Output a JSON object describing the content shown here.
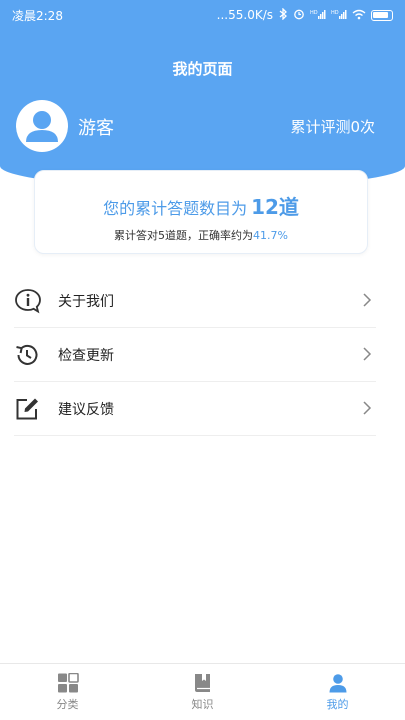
{
  "status_bar": {
    "time": "凌晨2:28",
    "network_speed": "...55.0K/s",
    "icons": [
      "bluetooth-icon",
      "alarm-icon",
      "signal-icon",
      "signal-icon",
      "wifi-icon",
      "battery-icon"
    ],
    "hd1": "HD",
    "hd2": "HD"
  },
  "header": {
    "title": "我的页面",
    "username": "游客",
    "eval_count": "累计评测0次"
  },
  "stats": {
    "main_prefix": "您的累计答题数目为",
    "main_value": "12道",
    "sub_prefix": "累计答对5道题，正确率约为",
    "sub_value": "41.7%"
  },
  "menu": {
    "items": [
      {
        "label": "关于我们",
        "icon": "info-icon"
      },
      {
        "label": "检查更新",
        "icon": "history-icon"
      },
      {
        "label": "建议反馈",
        "icon": "edit-icon"
      }
    ]
  },
  "bottom_nav": {
    "items": [
      {
        "label": "分类",
        "icon": "grid-icon"
      },
      {
        "label": "知识",
        "icon": "book-icon"
      },
      {
        "label": "我的",
        "icon": "person-icon",
        "active": true
      }
    ]
  },
  "colors": {
    "header_bg": "#5aa5f2",
    "accent": "#4d9be8",
    "text_dark": "#222222"
  }
}
